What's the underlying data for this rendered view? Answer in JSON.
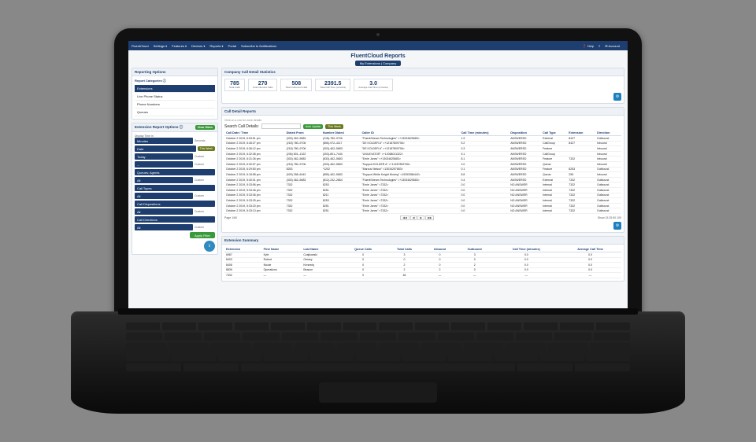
{
  "nav": {
    "brand": "FluentCloud",
    "items": [
      "Settings ▾",
      "Features ▾",
      "Devices ▾",
      "Reports ▾",
      "Portal",
      "Subscribe to Notifications"
    ],
    "right": [
      "❓ Help",
      "≡",
      "✉ Account"
    ]
  },
  "header": {
    "title": "FluentCloud Reports",
    "tab": "My Extensions  |  Company"
  },
  "sidebar": {
    "panel1_title": "Reporting Options",
    "categories_label": "Report Categories ⓘ",
    "categories": [
      {
        "label": "Extensions",
        "active": true
      },
      {
        "label": "Live Phone Status",
        "active": false
      },
      {
        "label": "Phone Numbers",
        "active": false
      },
      {
        "label": "Queues",
        "active": false
      }
    ],
    "panel2_title": "Extension Report Options ⓘ",
    "filter_pill": "Clear filters",
    "display_label": "Display Time in",
    "display_opts": [
      "Minutes",
      "Seconds"
    ],
    "this_week": "This Week",
    "rows": [
      {
        "bar": "Date",
        "lbl": ""
      },
      {
        "bar": "Today",
        "lbl": "Custom"
      },
      {
        "bar": "...",
        "lbl": "Custom"
      },
      {
        "bar": "Queues; Agents",
        "lbl": ""
      },
      {
        "bar": "All",
        "lbl": "Custom"
      },
      {
        "bar": "Call Types",
        "lbl": ""
      },
      {
        "bar": "All",
        "lbl": "Custom"
      },
      {
        "bar": "Call Dispositions",
        "lbl": ""
      },
      {
        "bar": "All",
        "lbl": "Custom"
      },
      {
        "bar": "Call Directions",
        "lbl": ""
      },
      {
        "bar": "All",
        "lbl": "Custom"
      }
    ],
    "apply": "Apply Filter",
    "export_icon": "⇩"
  },
  "stats_title": "Company Call Detail Statistics",
  "stats": [
    {
      "v": "785",
      "l": "Total Calls"
    },
    {
      "v": "270",
      "l": "Total Inbound Calls"
    },
    {
      "v": "508",
      "l": "Total Outbound Calls"
    },
    {
      "v": "2391.5",
      "l": "Total Call Time (minutes)"
    },
    {
      "v": "3.0",
      "l": "Average Call Time (minutes)"
    }
  ],
  "call_detail": {
    "title": "Call Detail Reports",
    "hint": "Click on a row for more details",
    "search_label": "Search Call Details:",
    "live_pill": "Auto Update",
    "headers": [
      "Call Date / Time",
      "Dialed From",
      "Number Dialed",
      "Caller ID",
      "Call Time (minutes)",
      "Disposition",
      "Call Type",
      "Extension",
      "Direction"
    ],
    "pager_left": "Page 1/60",
    "pager_show": "Show 15  25  50  100"
  },
  "call_rows": [
    [
      "October 2 2019, 6:53:51 pm",
      "(303) 462–5683",
      "(218)-780–9706",
      "\"FluentStream Technologies\" <+13034625683>",
      "1.9",
      "ANSWERED",
      "External",
      "8427",
      "Outbound"
    ],
    [
      "October 2 2019, 6:46:27 pm",
      "(218) 780–9706",
      "(855)-972–4117",
      "\"DE KOLDER A\" <+12187809706>",
      "5.2",
      "ANSWERED",
      "CallGroup",
      "8427",
      "Inbound"
    ],
    [
      "October 2 2019, 6:36:12 pm",
      "(218) 780–9706",
      "(303)-462–5683",
      "\"DE KOLDER A\" <+12187809706>",
      "0.3",
      "ANSWERED",
      "Feature",
      "",
      "Inbound"
    ],
    [
      "October 2 2019, 6:32:38 pm",
      "(206) 801–1322",
      "(303)-801–7440",
      "\"UNILEVATOR\" <+12068011322>",
      "5.1",
      "ANSWERED",
      "CallGroup",
      "",
      "Inbound"
    ],
    [
      "October 2 2019, 6:31:26 pm",
      "(303) 462–5683",
      "(833)-462–5683",
      "\"Ernie Jones\" <+13034625683>",
      "8.1",
      "ANSWERED",
      "Feature",
      "7332",
      "Inbound"
    ],
    [
      "October 2 2019, 6:30:57 pm",
      "(218) 780–9706",
      "(303)-462–5683",
      "\"Support KOLDER A\" <+12187809706>",
      "2.0",
      "ANSWERED",
      "Queue",
      "",
      "Inbound"
    ],
    [
      "October 2 2019, 6:29:50 pm",
      "8253",
      "*1202",
      "\"Marcus Nelson\" <13034257683>",
      "0.1",
      "ANSWERED",
      "Feature",
      "8253",
      "Outbound"
    ],
    [
      "October 2 2019, 6:18:58 pm",
      "(929) 258–6442",
      "(855)-462–5683",
      "\"Support White Knight Moving\" <19252586442>",
      "8.8",
      "ANSWERED",
      "Queue",
      "255",
      "Inbound"
    ],
    [
      "October 2 2019, 5:40:01 pm",
      "(303) 462–5683",
      "(812)-232–2864",
      "\"FluentStream Technologies\" <+13034625683>",
      "0.4",
      "ANSWERED",
      "External",
      "7332",
      "Outbound"
    ],
    [
      "October 2 2019, 5:33:56 pm",
      "7332",
      "8253",
      "\"Ernie Jones\" <7332>",
      "0.0",
      "NO ANSWER",
      "Internal",
      "7332",
      "Outbound"
    ],
    [
      "October 2 2019, 5:33:46 pm",
      "7332",
      "8251",
      "\"Ernie Jones\" <7332>",
      "0.0",
      "NO ANSWER",
      "Internal",
      "7332",
      "Outbound"
    ],
    [
      "October 2 2019, 5:33:36 pm",
      "7332",
      "8211",
      "\"Ernie Jones\" <7332>",
      "0.0",
      "NO ANSWER",
      "Internal",
      "7332",
      "Outbound"
    ],
    [
      "October 2 2019, 5:33:25 pm",
      "7332",
      "8253",
      "\"Ernie Jones\" <7332>",
      "0.0",
      "NO ANSWER",
      "Internal",
      "7332",
      "Outbound"
    ],
    [
      "October 2 2019, 5:33:20 pm",
      "7332",
      "8251",
      "\"Ernie Jones\" <7332>",
      "0.0",
      "NO ANSWER",
      "Internal",
      "7332",
      "Outbound"
    ],
    [
      "October 2 2019, 5:33:13 pm",
      "7332",
      "8251",
      "\"Ernie Jones\" <7332>",
      "0.0",
      "NO ANSWER",
      "Internal",
      "7332",
      "Outbound"
    ]
  ],
  "ext_summary": {
    "title": "Extension Summary",
    "headers": [
      "Extension",
      "First Name",
      "Last Name",
      "Queue Calls",
      "Total Calls",
      "Inbound",
      "Outbound",
      "Call Time (minutes)",
      "Average Call Time"
    ],
    "rows": [
      [
        "6987",
        "Kyle",
        "Czajkowski",
        "0",
        "3",
        "0",
        "3",
        "0.0",
        "0.0"
      ],
      [
        "8403",
        "Robert",
        "Greasy",
        "0",
        "0",
        "0",
        "0",
        "0.0",
        "0.0"
      ],
      [
        "8408",
        "Nicole",
        "Kennedy",
        "0",
        "2",
        "0",
        "2",
        "0.0",
        "0.0"
      ],
      [
        "8839",
        "Operations",
        "Beacon",
        "0",
        "2",
        "2",
        "0",
        "0.0",
        "0.0"
      ],
      [
        "7332",
        "—",
        "—",
        "0",
        "64",
        "—",
        "—",
        "—",
        "—"
      ]
    ]
  }
}
